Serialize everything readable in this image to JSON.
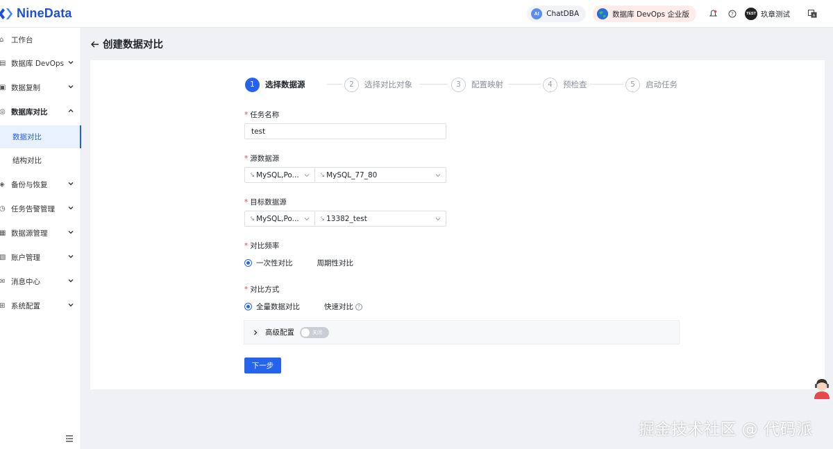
{
  "brand": {
    "name": "NineData",
    "color": "#1d4fd8"
  },
  "header": {
    "chat_label": "ChatDBA",
    "chat_icon_text": "AI",
    "edition_label": "数据库 DevOps 企业版",
    "avatar_text": "TEST",
    "user_name": "玖章测试",
    "icons": [
      "bell-icon",
      "help-icon",
      "language-icon"
    ]
  },
  "sidebar": {
    "items": [
      {
        "label": "工作台",
        "icon": "home-icon"
      },
      {
        "label": "数据库 DevOps",
        "icon": "devops-icon"
      },
      {
        "label": "数据复制",
        "icon": "replication-icon"
      },
      {
        "label": "数据库对比",
        "icon": "compare-icon"
      },
      {
        "label": "备份与恢复",
        "icon": "backup-icon"
      },
      {
        "label": "任务告警管理",
        "icon": "alert-icon"
      },
      {
        "label": "数据源管理",
        "icon": "datasource-icon"
      },
      {
        "label": "账户管理",
        "icon": "account-icon"
      },
      {
        "label": "消息中心",
        "icon": "message-icon"
      },
      {
        "label": "系统配置",
        "icon": "settings-icon"
      }
    ],
    "sub_items": [
      {
        "label": "数据对比",
        "active": true
      },
      {
        "label": "结构对比",
        "active": false
      }
    ],
    "accent": "#1d5ee8"
  },
  "page": {
    "title": "创建数据对比"
  },
  "steps": [
    {
      "num": "1",
      "label": "选择数据源",
      "active": true
    },
    {
      "num": "2",
      "label": "选择对比对象",
      "active": false
    },
    {
      "num": "3",
      "label": "配置映射",
      "active": false
    },
    {
      "num": "4",
      "label": "预检查",
      "active": false
    },
    {
      "num": "5",
      "label": "启动任务",
      "active": false
    }
  ],
  "form": {
    "required_mark": "*",
    "task_name": {
      "label": "任务名称",
      "value": "test"
    },
    "source": {
      "label": "源数据源",
      "type_value": "MySQL,Po...",
      "instance_value": "MySQL_77_80"
    },
    "target": {
      "label": "目标数据源",
      "type_value": "MySQL,Po...",
      "instance_value": "13382_test"
    },
    "frequency": {
      "label": "对比频率",
      "options": [
        "一次性对比",
        "周期性对比"
      ],
      "selected": 0
    },
    "method": {
      "label": "对比方式",
      "options": [
        "全量数据对比",
        "快速对比"
      ],
      "selected": 0,
      "help_text": "?"
    },
    "advanced": {
      "label": "高级配置",
      "toggle_text": "关闭",
      "enabled": false
    },
    "next_label": "下一步"
  },
  "primary_color": "#2563eb",
  "watermark": "掘金技术社区 @ 代码派"
}
